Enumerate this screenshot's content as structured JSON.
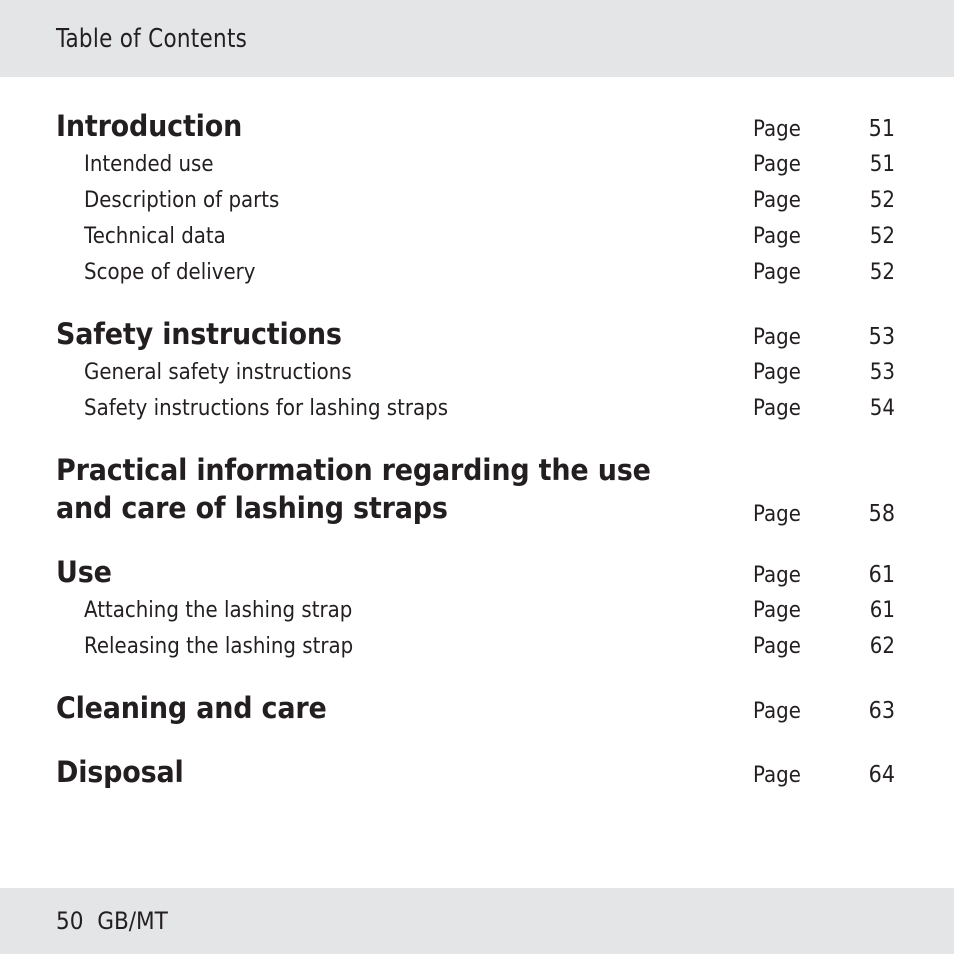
{
  "header": {
    "title": "Table of Contents"
  },
  "footer": {
    "text": "50  GB/MT",
    "page_number": "50",
    "language_code": "GB/MT"
  },
  "page_label_text": "Page",
  "toc": {
    "groups": [
      {
        "heading": {
          "label": "Introduction",
          "page_label": "Page",
          "page": "51"
        },
        "items": [
          {
            "label": "Intended use",
            "page_label": "Page",
            "page": "51"
          },
          {
            "label": "Description of parts",
            "page_label": "Page",
            "page": "52"
          },
          {
            "label": "Technical data",
            "page_label": "Page",
            "page": "52"
          },
          {
            "label": "Scope of delivery",
            "page_label": "Page",
            "page": "52"
          }
        ]
      },
      {
        "heading": {
          "label": "Safety instructions",
          "page_label": "Page",
          "page": "53"
        },
        "items": [
          {
            "label": "General safety instructions",
            "page_label": "Page",
            "page": "53"
          },
          {
            "label": "Safety instructions for lashing straps",
            "page_label": "Page",
            "page": "54"
          }
        ]
      },
      {
        "heading": {
          "label": "Practical information regarding the use and care of lashing straps",
          "page_label": "Page",
          "page": "58"
        },
        "items": []
      },
      {
        "heading": {
          "label": "Use",
          "page_label": "Page",
          "page": "61"
        },
        "items": [
          {
            "label": "Attaching the lashing strap",
            "page_label": "Page",
            "page": "61"
          },
          {
            "label": "Releasing the lashing strap",
            "page_label": "Page",
            "page": "62"
          }
        ]
      },
      {
        "heading": {
          "label": "Cleaning and care",
          "page_label": "Page",
          "page": "63"
        },
        "items": []
      },
      {
        "heading": {
          "label": "Disposal",
          "page_label": "Page",
          "page": "64"
        },
        "items": []
      }
    ]
  },
  "colors": {
    "band_gray": "#e4e5e7",
    "text": "#231f20",
    "leader_dots": "#3a3a3c",
    "page_background": "#ffffff"
  }
}
